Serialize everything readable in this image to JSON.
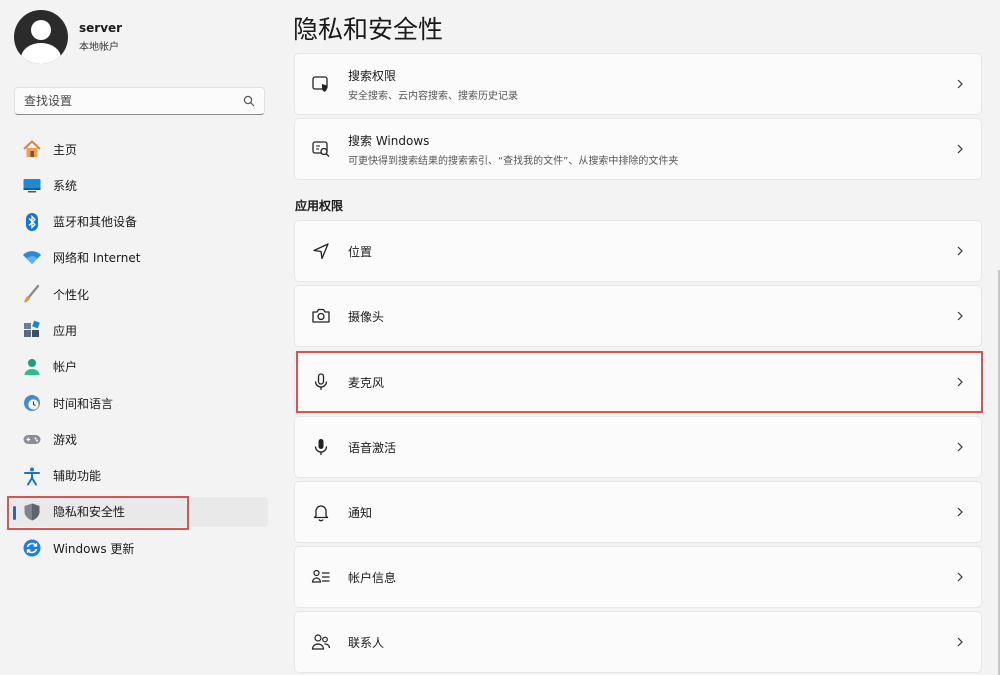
{
  "profile": {
    "name": "server",
    "account_type": "本地帐户"
  },
  "search": {
    "placeholder": "查找设置"
  },
  "nav": [
    {
      "key": "home",
      "label": "主页",
      "icon": "home-icon"
    },
    {
      "key": "system",
      "label": "系统",
      "icon": "monitor-icon"
    },
    {
      "key": "bluetooth",
      "label": "蓝牙和其他设备",
      "icon": "bluetooth-icon"
    },
    {
      "key": "network",
      "label": "网络和 Internet",
      "icon": "wifi-icon"
    },
    {
      "key": "personalization",
      "label": "个性化",
      "icon": "brush-icon"
    },
    {
      "key": "apps",
      "label": "应用",
      "icon": "apps-icon"
    },
    {
      "key": "accounts",
      "label": "帐户",
      "icon": "person-icon"
    },
    {
      "key": "time-language",
      "label": "时间和语言",
      "icon": "globe-clock-icon"
    },
    {
      "key": "gaming",
      "label": "游戏",
      "icon": "gamepad-icon"
    },
    {
      "key": "accessibility",
      "label": "辅助功能",
      "icon": "accessibility-icon"
    },
    {
      "key": "privacy",
      "label": "隐私和安全性",
      "icon": "shield-icon",
      "selected": true
    },
    {
      "key": "windows-update",
      "label": "Windows 更新",
      "icon": "update-icon"
    }
  ],
  "main": {
    "title": "隐私和安全性",
    "top_cards": [
      {
        "title": "搜索权限",
        "desc": "安全搜索、云内容搜索、搜索历史记录",
        "icon": "search-permission-icon"
      },
      {
        "title": "搜索 Windows",
        "desc": "可更快得到搜索结果的搜索索引、“查找我的文件”、从搜索中排除的文件夹",
        "icon": "search-windows-icon"
      }
    ],
    "section_title": "应用权限",
    "permissions": [
      {
        "title": "位置",
        "icon": "location-icon"
      },
      {
        "title": "摄像头",
        "icon": "camera-icon"
      },
      {
        "title": "麦克风",
        "icon": "microphone-icon",
        "highlighted": true
      },
      {
        "title": "语音激活",
        "icon": "voice-activation-icon"
      },
      {
        "title": "通知",
        "icon": "bell-icon"
      },
      {
        "title": "帐户信息",
        "icon": "account-info-icon"
      },
      {
        "title": "联系人",
        "icon": "contacts-icon"
      }
    ]
  },
  "colors": {
    "accent": "#2769b8",
    "highlight_border": "#d9534f",
    "background": "#f3f3f3",
    "card": "#fbfbfb"
  }
}
